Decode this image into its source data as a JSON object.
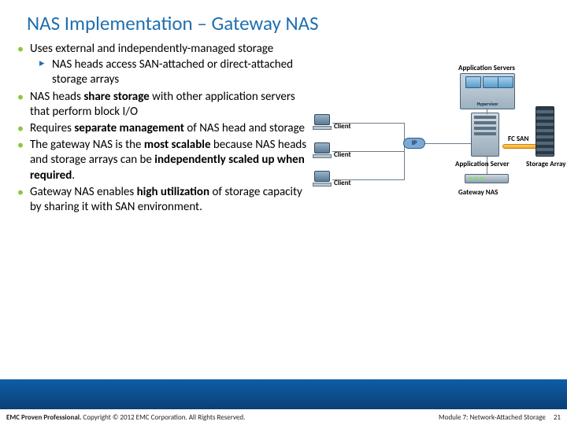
{
  "title": "NAS Implementation – Gateway NAS",
  "bullets": {
    "b1": "Uses external and independently-managed storage",
    "b1s1": "NAS heads access SAN-attached or direct-attached storage arrays",
    "b2_pre": "NAS heads ",
    "b2_bold": "share storage",
    "b2_post": " with other application servers that perform block I/O",
    "b3_pre": "Requires ",
    "b3_bold": "separate management",
    "b3_post": " of NAS head and storage",
    "b4_pre": "The gateway NAS is the ",
    "b4_bold1": "most scalable",
    "b4_mid": " because NAS heads and storage arrays can be ",
    "b4_bold2": "independently scaled up when required",
    "b4_post": ".",
    "b5_pre": "Gateway NAS enables ",
    "b5_bold": "high utilization",
    "b5_post": " of storage capacity by sharing it with SAN environment."
  },
  "diagram": {
    "app_servers": "Application Servers",
    "hypervisor": "Hypervisor",
    "client": "Client",
    "ip": "IP",
    "fcsan": "FC SAN",
    "app_server": "Application Server",
    "gateway_nas": "Gateway NAS",
    "storage_array": "Storage Array"
  },
  "footer": {
    "left_bold": "EMC Proven Professional.",
    "left_rest": " Copyright © 2012 EMC Corporation. All Rights Reserved.",
    "module": "Module 7: Network-Attached Storage",
    "page": "21"
  }
}
